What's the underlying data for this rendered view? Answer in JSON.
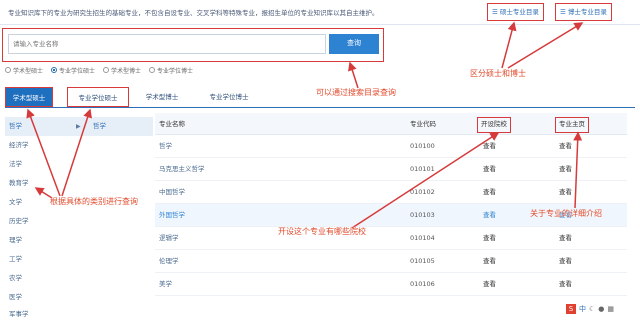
{
  "notice": "专业知识库下的专业为研究生招生的基础专业，不包含自设专业、交叉学科等特殊专业，报招生单位的专业知识库以其自主维护。",
  "category_buttons": [
    {
      "label": "硕士专业目录",
      "icon": "list-icon"
    },
    {
      "label": "博士专业目录",
      "icon": "list-icon"
    }
  ],
  "search": {
    "placeholder": "请输入专业名称",
    "button": "查询"
  },
  "radios": [
    {
      "label": "学术型硕士",
      "checked": false
    },
    {
      "label": "专业学位硕士",
      "checked": true
    },
    {
      "label": "学术型博士",
      "checked": false
    },
    {
      "label": "专业学位博士",
      "checked": false
    }
  ],
  "tabs": [
    "学术型硕士",
    "专业学位硕士",
    "学术型博士",
    "专业学位博士"
  ],
  "left_categories": [
    {
      "label": "哲学",
      "sub": "哲学"
    },
    {
      "label": "经济学"
    },
    {
      "label": "法学"
    },
    {
      "label": "教育学"
    },
    {
      "label": "文学"
    },
    {
      "label": "历史学"
    },
    {
      "label": "理学"
    },
    {
      "label": "工学"
    },
    {
      "label": "农学"
    },
    {
      "label": "医学"
    },
    {
      "label": "军事学"
    }
  ],
  "table": {
    "headers": [
      "专业名称",
      "专业代码",
      "开设院校",
      "专业主页"
    ],
    "rows": [
      {
        "name": "哲学",
        "code": "010100",
        "schools": "查看",
        "home": "查看"
      },
      {
        "name": "马克思主义哲学",
        "code": "010101",
        "schools": "查看",
        "home": "查看"
      },
      {
        "name": "中国哲学",
        "code": "010102",
        "schools": "查看",
        "home": "查看"
      },
      {
        "name": "外国哲学",
        "code": "010103",
        "schools": "查看",
        "home": "查看"
      },
      {
        "name": "逻辑学",
        "code": "010104",
        "schools": "查看",
        "home": "查看"
      },
      {
        "name": "伦理学",
        "code": "010105",
        "schools": "查看",
        "home": "查看"
      },
      {
        "name": "美学",
        "code": "010106",
        "schools": "查看",
        "home": "查看"
      }
    ]
  },
  "annotations": {
    "search_tip": "可以通过搜索目录查询",
    "masters_doctors": "区分硕士和博士",
    "category_tip": "根据具体的类别进行查询",
    "schools_tip": "开设这个专业有哪些院校",
    "homepage_tip": "关于专业的详细介绍"
  },
  "toolbar": {
    "logo": "S",
    "lang": "中"
  },
  "colors": {
    "accent": "#2d82d2",
    "annotation": "#e14a2c",
    "tab_active": "#1f6fbf"
  }
}
